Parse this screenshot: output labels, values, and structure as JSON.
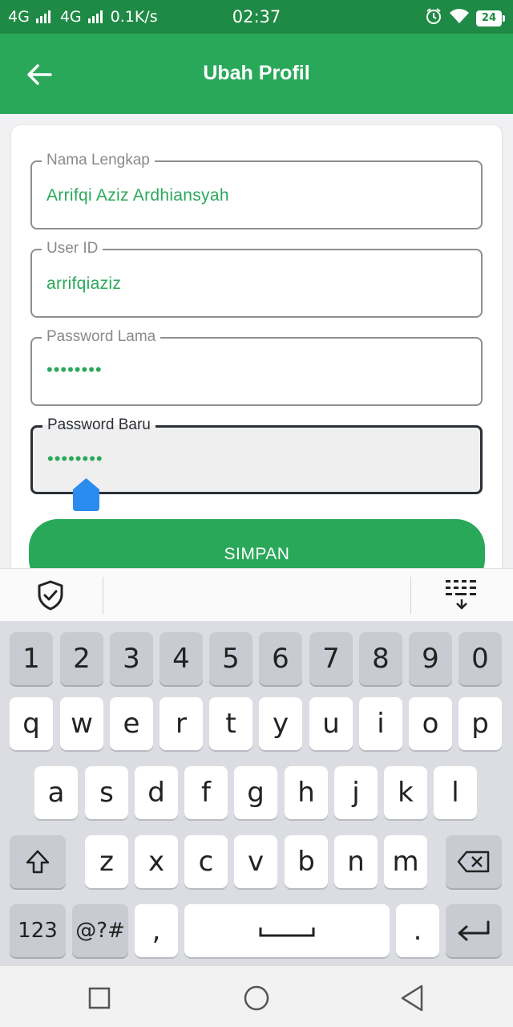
{
  "status_bar": {
    "network1": "4G",
    "network2": "4G",
    "speed": "0.1K/s",
    "time": "02:37",
    "battery": "24"
  },
  "app_bar": {
    "title": "Ubah Profil",
    "back_icon": "arrow-left-icon"
  },
  "form": {
    "fields": [
      {
        "label": "Nama Lengkap",
        "value": "Arrifqi Aziz Ardhiansyah",
        "type": "text",
        "focused": false
      },
      {
        "label": "User ID",
        "value": "arrifqiaziz",
        "type": "text",
        "focused": false
      },
      {
        "label": "Password Lama",
        "value": "••••••••",
        "type": "password",
        "focused": false
      },
      {
        "label": "Password Baru",
        "value": "••••••••",
        "type": "password",
        "focused": true
      }
    ],
    "save_label": "SIMPAN"
  },
  "keyboard": {
    "row_numbers": [
      "1",
      "2",
      "3",
      "4",
      "5",
      "6",
      "7",
      "8",
      "9",
      "0"
    ],
    "row1": [
      "q",
      "w",
      "e",
      "r",
      "t",
      "y",
      "u",
      "i",
      "o",
      "p"
    ],
    "row2": [
      "a",
      "s",
      "d",
      "f",
      "g",
      "h",
      "j",
      "k",
      "l"
    ],
    "row3": [
      "z",
      "x",
      "c",
      "v",
      "b",
      "n",
      "m"
    ],
    "num_label": "123",
    "sym_label": "@?#",
    "comma": ",",
    "period": "."
  },
  "colors": {
    "status_bar": "#1e8a45",
    "app_bar": "#2aa85a",
    "accent_text": "#2aa85a",
    "cursor_handle": "#2b8cf0"
  }
}
